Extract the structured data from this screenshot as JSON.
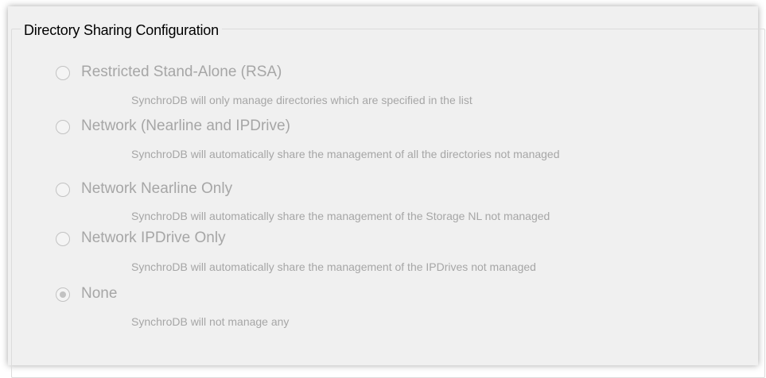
{
  "group": {
    "title": "Directory Sharing Configuration"
  },
  "options": [
    {
      "label": "Restricted Stand-Alone (RSA)",
      "description": "SynchroDB will only manage directories which are specified in the list",
      "checked": false
    },
    {
      "label": "Network (Nearline and IPDrive)",
      "description": "SynchroDB will automatically share the management of all the directories not managed",
      "checked": false
    },
    {
      "label": "Network Nearline Only",
      "description": "SynchroDB will automatically share the management of the Storage NL not managed",
      "checked": false
    },
    {
      "label": "Network IPDrive Only",
      "description": "SynchroDB will automatically share the management of the IPDrives not managed",
      "checked": false
    },
    {
      "label": "None",
      "description": "SynchroDB will not manage any",
      "checked": true
    }
  ],
  "colors": {
    "panel_background": "#f0f0f0",
    "disabled_text": "#a6a6a6",
    "title_text": "#000000"
  }
}
